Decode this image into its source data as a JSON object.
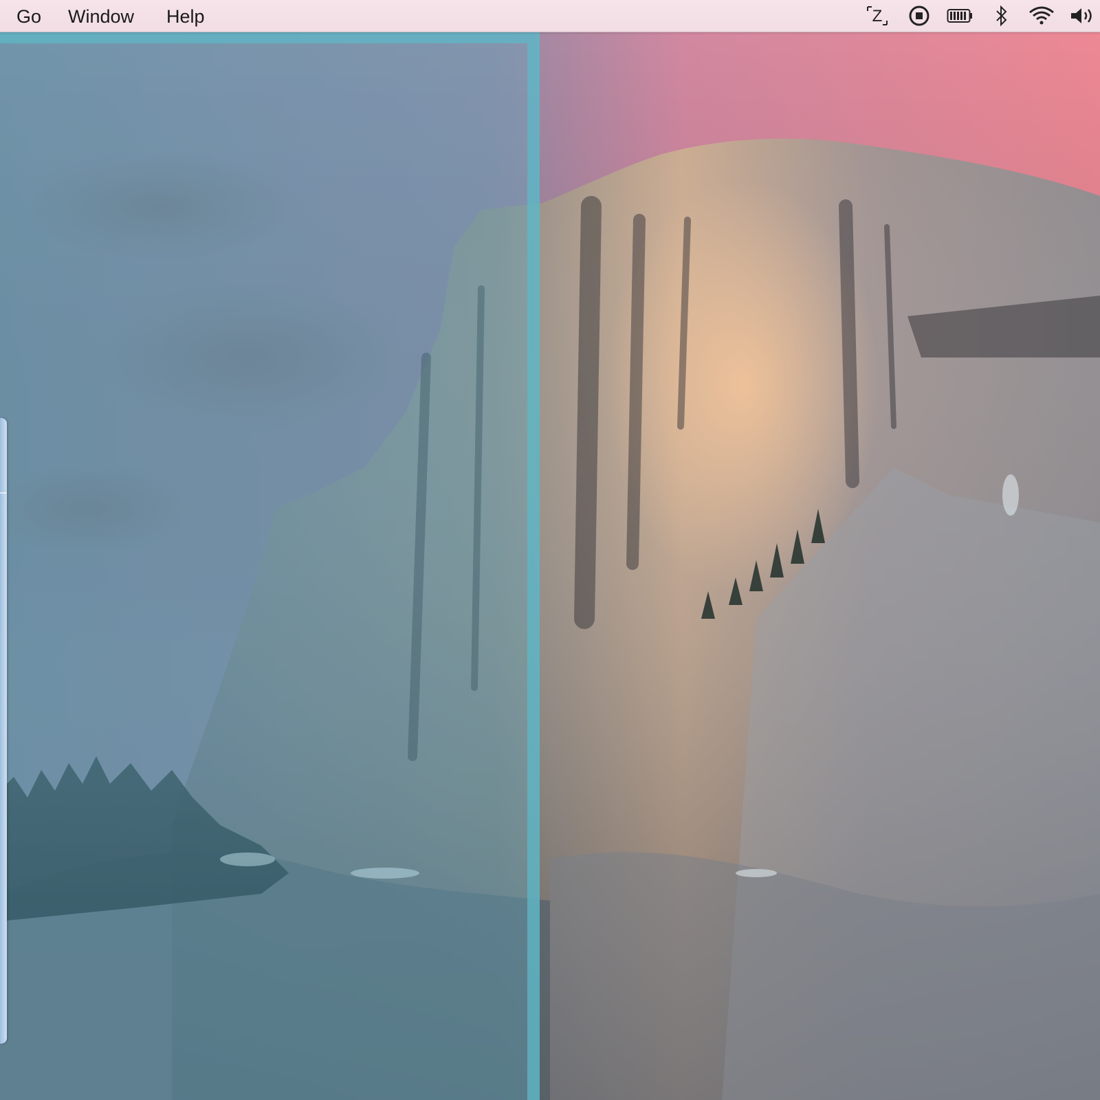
{
  "menubar": {
    "items": [
      {
        "label": "Go"
      },
      {
        "label": "Window"
      },
      {
        "label": "Help"
      }
    ],
    "status_icons": [
      {
        "name": "zoom-z-icon",
        "glyph": "Z"
      },
      {
        "name": "screen-record-icon"
      },
      {
        "name": "battery-icon"
      },
      {
        "name": "bluetooth-icon"
      },
      {
        "name": "wifi-icon"
      },
      {
        "name": "volume-icon"
      }
    ]
  },
  "colors": {
    "menubar_bg": "#f3e0e6",
    "snap_overlay": "#48a4ba",
    "sky_pink": "#e88a9c",
    "sky_grey": "#7f8796",
    "granite": "#8c8a8e"
  }
}
